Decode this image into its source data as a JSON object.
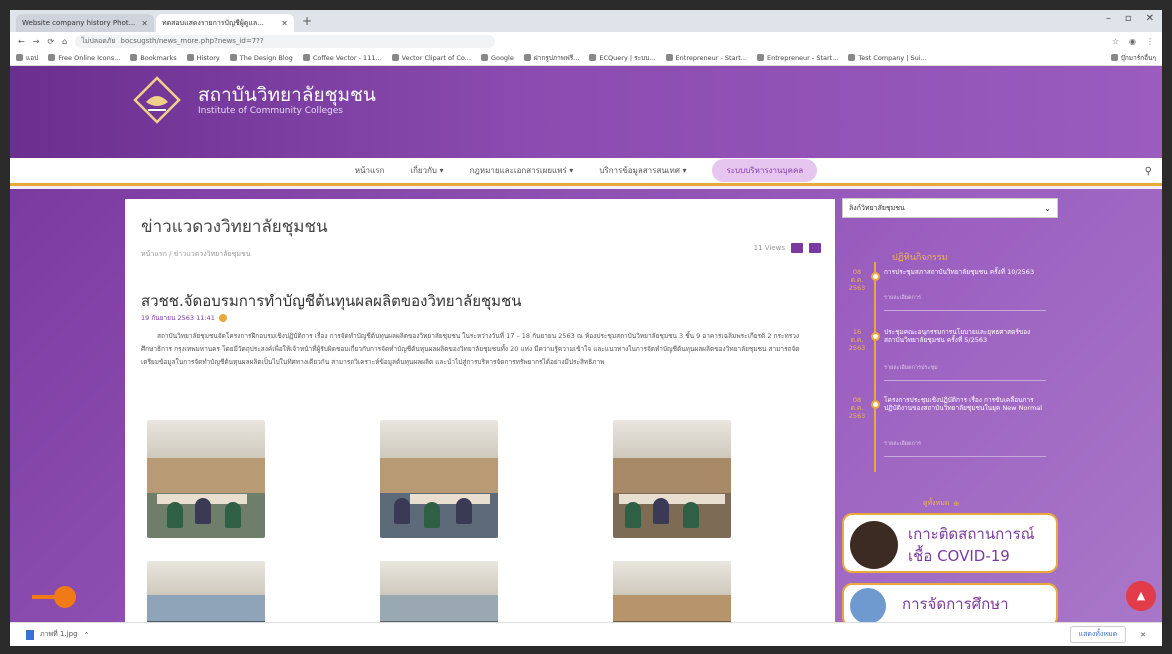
{
  "browser": {
    "tabs": [
      {
        "label": "Website company history Phot..."
      },
      {
        "label": "ทดสอบแสดงรายการบัญชีผู้ดูแล..."
      }
    ],
    "new_tab_icon": "plus-icon",
    "url": "bocsugsth/news_more.php?news_id=7??",
    "url_prefix": "ไม่ปลอดภัย",
    "bookmarks": [
      "แอป",
      "Free Online Icons...",
      "Bookmarks",
      "History",
      "The Design Blog",
      "Coffee Vector - 111...",
      "Vector Clipart of Co...",
      "Google",
      "ฝากรูปภาพฟรี...",
      "ECQuery | ระบบ...",
      "Entrepreneur - Start...",
      "Entrepreneur - Start...",
      "Test Company | Sui..."
    ],
    "bookmarks_right": "บุ๊กมาร์กอื่นๆ"
  },
  "site": {
    "name": "สถาบันวิทยาลัยชุมชน",
    "subtitle": "Institute of Community Colleges",
    "nav": [
      "หน้าแรก",
      "เกี่ยวกับ ▾",
      "กฎหมายและเอกสารเผยแพร่ ▾",
      "บริการข้อมูลสารสนเทศ ▾",
      "ระบบบริหารงานบุคคล"
    ],
    "search_icon": "search-icon"
  },
  "article": {
    "page_title": "ข่าวแวดวงวิทยาลัยชุมชน",
    "breadcrumb": "หน้าแรก / ข่าวแวดวงวิทยาลัยชุมชน",
    "views": "11 Views",
    "title": "สวชช.จัดอบรมการทำบัญชีต้นทุนผลผลิตของวิทยาลัยชุมชน",
    "date": "19 กันยายน 2563 11:41",
    "body": "สถาบันวิทยาลัยชุมชนจัดโครงการฝึกอบรมเชิงปฏิบัติการ เรื่อง การจัดทำบัญชีต้นทุนผลผลิตของวิทยาลัยชุมชน ในระหว่างวันที่ 17 – 18 กันยายน 2563 ณ ห้องประชุมสถาบันวิทยาลัยชุมชน 3 ชั้น 9 อาคารเฉลิมพระเกียรติ 2 กระทรวงศึกษาธิการ กรุงเทพมหานคร โดยมีวัตถุประสงค์เพื่อให้เจ้าหน้าที่ผู้รับผิดชอบเกี่ยวกับการจัดทำบัญชีต้นทุนผลผลิตของวิทยาลัยชุมชนทั้ง 20 แห่ง มีความรู้ความเข้าใจ และแนวทางในการจัดทำบัญชีต้นทุนผลผลิตของวิทยาลัยชุมชน สามารถจัดเตรียมข้อมูลในการจัดทำบัญชีต้นทุนผลผลิตเป็นไปในทิศทางเดียวกัน สามารถวิเคราะห์ข้อมูลต้นทุนผลผลิต และนำไปสู่การบริหารจัดการทรัพยากรได้อย่างมีประสิทธิภาพ"
  },
  "sidebar": {
    "select_value": "ลิงก์วิทยาลัยชุมชน",
    "calendar_heading": "ปฏิทินกิจกรรม",
    "events": [
      {
        "date": "08 ต.ค. 2563",
        "text": "การประชุมสภาสถาบันวิทยาลัยชุมชน ครั้งที่ 10/2563",
        "meta": "รายละเอียดการ"
      },
      {
        "date": "16 ต.ค. 2563",
        "text": "ประชุมคณะอนุกรรมการนโยบายและยุทธศาสตร์ของสถาบันวิทยาลัยชุมชน ครั้งที่ 5/2563",
        "meta": "รายละเอียดการประชุม"
      },
      {
        "date": "08 ต.ค. 2563",
        "text": "โครงการประชุมเชิงปฏิบัติการ เรื่อง การขับเคลื่อนการปฏิบัติงานของสถาบันวิทยาลัยชุมชนในยุค New Normal",
        "meta": "รายละเอียดการ"
      }
    ],
    "all_events": "ดูทั้งหมด",
    "banner_covid": "เกาะติดสถานการณ์ เชื้อ COVID-19",
    "banner_edu": "การจัดการศึกษา"
  },
  "downloadbar": {
    "file": "ภาพที่ 1.jpg",
    "show_all": "แสดงทั้งหมด",
    "close_icon": "close-icon"
  },
  "colors": {
    "purple": "#7b3aa0",
    "gold": "#e9a83a",
    "red": "#e23c4b",
    "orange": "#f07a16"
  }
}
